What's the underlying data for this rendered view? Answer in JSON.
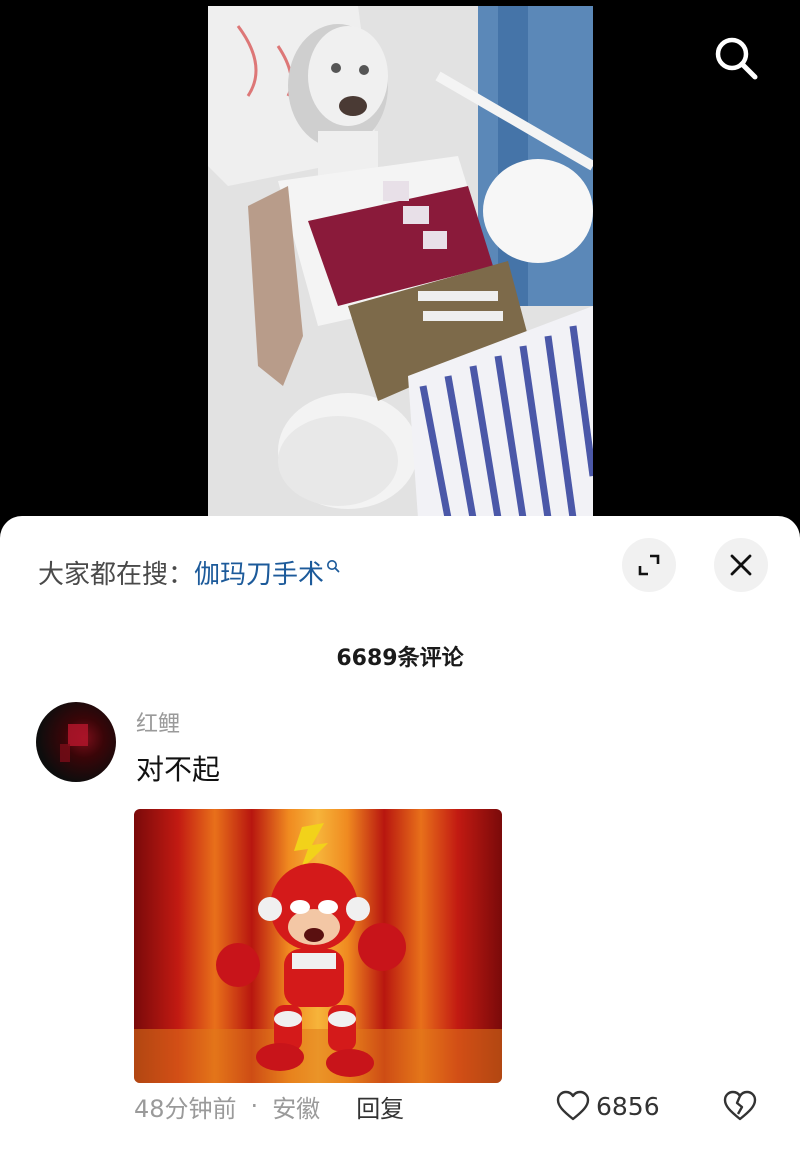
{
  "search": {
    "icon": "search-icon"
  },
  "hot_search": {
    "prefix": "大家都在搜：",
    "term": "伽玛刀手术"
  },
  "sheet": {
    "comment_count": "6689条评论"
  },
  "comment": {
    "username": "红鲤",
    "text": "对不起",
    "time": "48分钟前",
    "separator": "·",
    "location": "安徽",
    "reply_label": "回复",
    "likes": "6856"
  },
  "colors": {
    "link": "#1c5a9a",
    "muted": "#9a9a9a",
    "sheet_bg": "#ffffff"
  }
}
